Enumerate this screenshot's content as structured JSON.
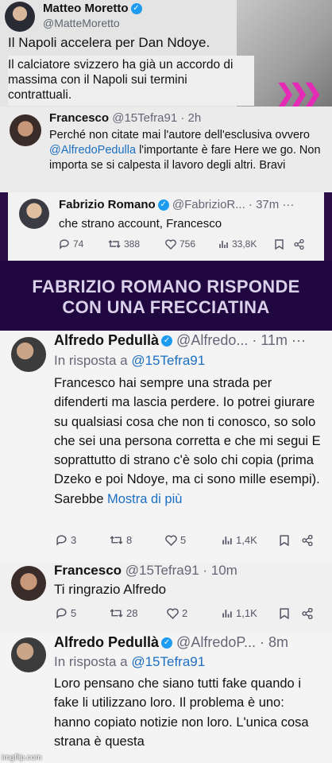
{
  "tweet1": {
    "name": "Matteo Moretto",
    "handle": "@MatteMoretto",
    "title": "Il Napoli accelera per Dan Ndoye.",
    "text": "Il calciatore svizzero ha già un accordo di massima con il Napoli sui termini contrattuali."
  },
  "tweet2": {
    "name": "Francesco",
    "meta": "@15Tefra91 · 2h",
    "text_pre": "Perché non citate mai l'autore dell'esclusiva ovvero ",
    "mention": "@AlfredoPedulla",
    "text_post": " l'importante è fare Here we go. Non importa se si calpesta il lavoro degli altri. Bravi"
  },
  "tweet3": {
    "name": "Fabrizio Romano",
    "meta": "@FabrizioR... · 37m",
    "text": "che strano account, Francesco",
    "replies": "74",
    "retweets": "388",
    "likes": "756",
    "views": "33,8K"
  },
  "banner": {
    "line1": "FABRIZIO ROMANO RISPONDE",
    "line2": "CON UNA FRECCIATINA"
  },
  "tweet4": {
    "name": "Alfredo Pedullà",
    "meta": "@Alfredo... · 11m",
    "reply_prefix": "In risposta a ",
    "reply_to": "@15Tefra91",
    "text": "Francesco hai sempre una strada per difenderti ma lascia perdere. Io potrei giurare su qualsiasi cosa che non ti conosco, so solo che sei una persona corretta e che mi segui E soprattutto di strano c'è solo chi copia (prima Dzeko e poi Ndoye, ma ci sono mille esempi). Sarebbe ",
    "more": "Mostra di più",
    "replies": "3",
    "retweets": "8",
    "likes": "5",
    "views": "1,4K"
  },
  "tweet5": {
    "name": "Francesco",
    "meta": "@15Tefra91 · 10m",
    "text": "Ti ringrazio Alfredo",
    "replies": "5",
    "retweets": "28",
    "likes": "2",
    "views": "1,1K"
  },
  "tweet6": {
    "name": "Alfredo Pedullà",
    "meta": "@AlfredoP... · 8m",
    "reply_prefix": "In risposta a ",
    "reply_to": "@15Tefra91",
    "text": "Loro pensano che siano tutti fake quando i fake li utilizzano loro. Il problema è uno: hanno copiato notizie non loro. L'unica cosa strana è questa"
  },
  "watermark": "imgflip.com",
  "icons": [
    "verified-badge-icon",
    "reply-icon",
    "retweet-icon",
    "like-icon",
    "views-icon",
    "bookmark-icon",
    "share-icon"
  ]
}
